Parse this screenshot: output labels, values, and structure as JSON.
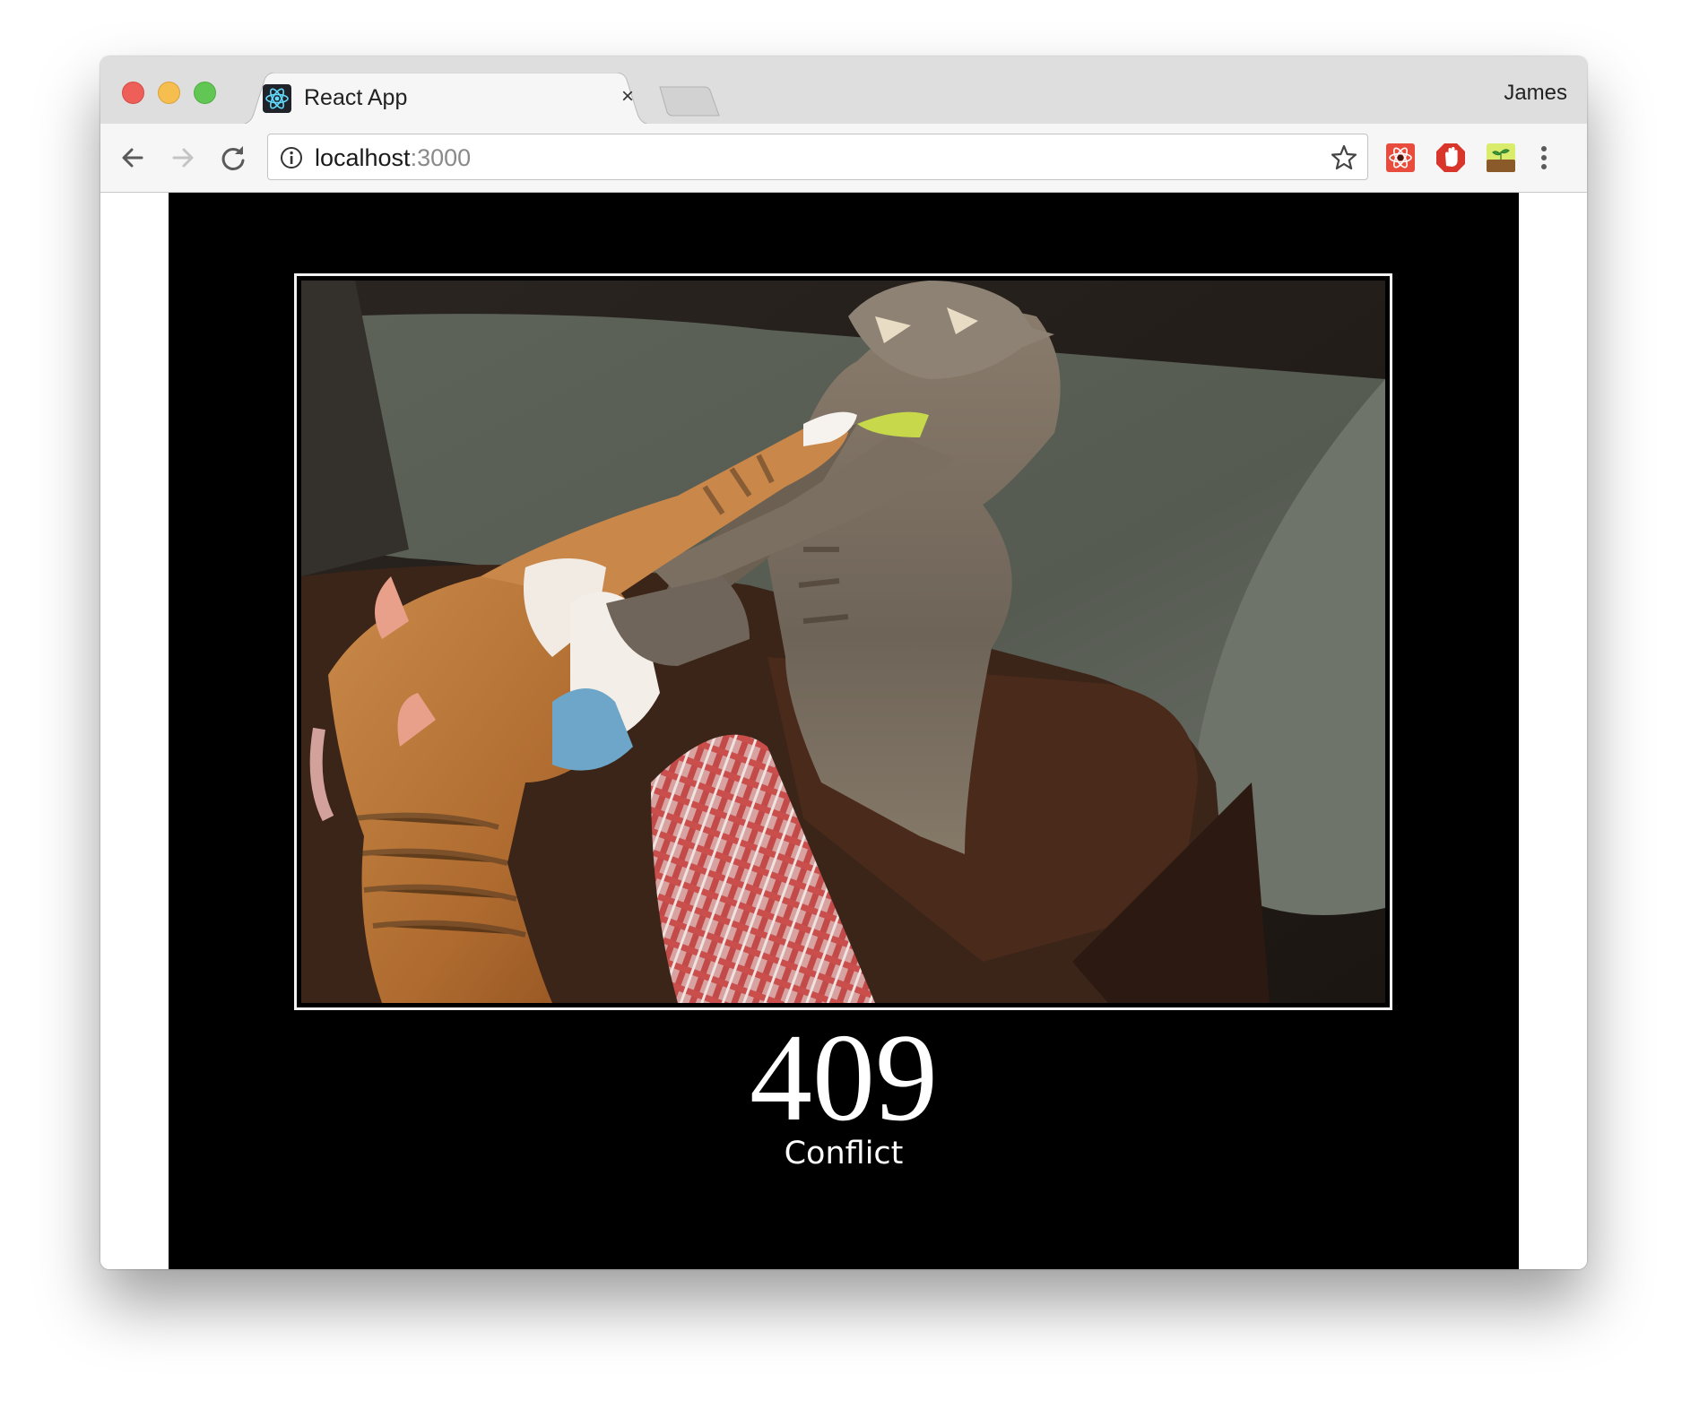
{
  "browser": {
    "tab_title": "React App",
    "tab_close_glyph": "×",
    "profile_name": "James",
    "url_host": "localhost",
    "url_port": ":3000",
    "icons": {
      "favicon": "react-logo-icon",
      "back": "back-arrow-icon",
      "forward": "forward-arrow-icon",
      "reload": "reload-icon",
      "site_info": "info-icon",
      "bookmark": "star-icon",
      "menu": "kebab-menu-icon",
      "extensions": [
        "react-devtools-extension-icon",
        "adblock-hand-extension-icon",
        "plant-extension-icon"
      ]
    }
  },
  "page": {
    "status_code": "409",
    "status_text": "Conflict",
    "image": "two-cats-fighting-photo"
  }
}
